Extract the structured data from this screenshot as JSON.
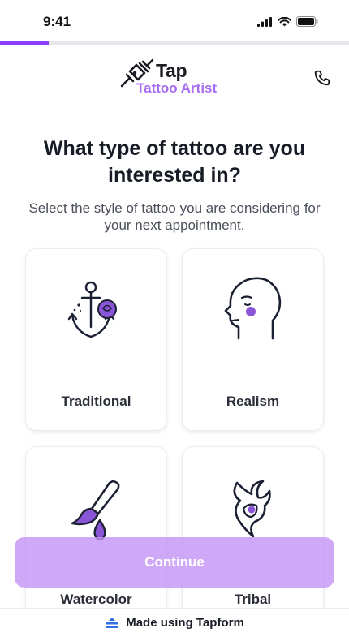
{
  "status_bar": {
    "time": "9:41"
  },
  "progress": {
    "fraction": 0.14
  },
  "brand": {
    "name": "Tap",
    "tagline": "Tattoo Artist"
  },
  "question": {
    "title": "What type of tattoo are you interested in?",
    "subtitle": "Select the style of tattoo you are considering for your next appointment."
  },
  "options": [
    {
      "label": "Traditional",
      "icon": "anchor-rose-icon"
    },
    {
      "label": "Realism",
      "icon": "head-profile-icon"
    },
    {
      "label": "Watercolor",
      "icon": "paintbrush-icon"
    },
    {
      "label": "Tribal",
      "icon": "tribal-flame-icon"
    }
  ],
  "continue_label": "Continue",
  "footer": {
    "text": "Made using Tapform"
  },
  "colors": {
    "accent": "#8a3ffc",
    "accent_light": "#c496f5",
    "icon_purple": "#8b55d8",
    "ink": "#1b2033"
  }
}
